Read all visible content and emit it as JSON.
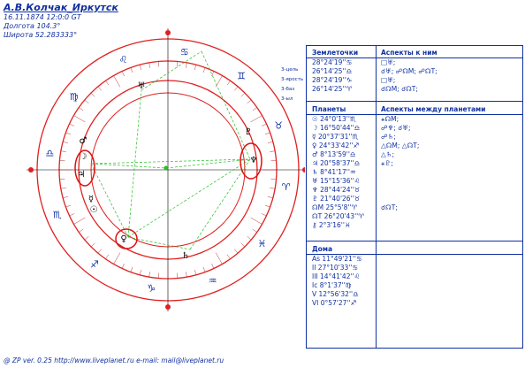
{
  "header": {
    "title": "А.В.Колчак_Иркутск",
    "date_line": "16.11.1874 12:0:0 GT",
    "longitude": "Долгота 104.3°",
    "latitude": "Широта 52.283333°"
  },
  "colors": {
    "text": "#1030a0",
    "outer_ring": "#e02020",
    "aspect_green": "#20c020",
    "circle_red": "#e01010"
  },
  "chart_labels": {
    "zodiac_signs": [
      "♌",
      "♋",
      "♊",
      "♉",
      "♈",
      "♓",
      "♒",
      "♑",
      "♐",
      "♏",
      "♎",
      "♍"
    ],
    "planet_glyphs": {
      "saturn": "♅",
      "mercury": "☿",
      "pluto": "♇",
      "neptune": "♆",
      "sun": "☉",
      "moon": "☽",
      "venus": "♀",
      "mars": "♂",
      "jupiter": "♃",
      "saturn2": "♄"
    },
    "legend": [
      "3-цель",
      "3-ярость",
      "3-баз",
      "3-ыл"
    ]
  },
  "table": {
    "earthpoints": {
      "head1": "Землеточки",
      "head2": "Аспекты к ним",
      "rows": [
        {
          "c1": "28°24'19''♋",
          "c2": "□♅;"
        },
        {
          "c1": "26°14'25''♎",
          "c2": "☌♅; ☍☊M; ☍☊T;"
        },
        {
          "c1": "28°24'19''♑",
          "c2": "□♅;"
        },
        {
          "c1": "26°14'25''♈",
          "c2": "☌☊M; ☌☊T;"
        }
      ]
    },
    "planets": {
      "head1": "Планеты",
      "head2": "Аспекты между планетами",
      "rows": [
        {
          "c1": "☉ 24°0'13''♏",
          "c2": "⚹☊M;"
        },
        {
          "c1": "☽ 16°50'44''♎",
          "c2": "☍♆; ☌♅;"
        },
        {
          "c1": "☿ 20°37'31''♏",
          "c2": "☍♄;"
        },
        {
          "c1": "♀ 24°33'42''♐",
          "c2": "△☊M; △☊T;"
        },
        {
          "c1": "♂ 8°13'59''♎",
          "c2": "△♄;"
        },
        {
          "c1": "♃ 20°58'37''♎",
          "c2": "⚹♇;"
        },
        {
          "c1": "♄ 8°41'17''♒",
          "c2": ""
        },
        {
          "c1": "♅ 15°15'36''♌",
          "c2": ""
        },
        {
          "c1": "♆ 28°44'24''♉",
          "c2": ""
        },
        {
          "c1": "♇ 21°40'26''♉",
          "c2": ""
        },
        {
          "c1": "☊M 25°5'8''♈",
          "c2": "☌☊T;"
        },
        {
          "c1": "☊T 26°20'43''♈",
          "c2": ""
        },
        {
          "c1": "⚷ 2°3'16''♓",
          "c2": ""
        }
      ]
    },
    "houses": {
      "head1": "Дома",
      "rows": [
        {
          "c1": "As 11°49'21''♋"
        },
        {
          "c1": "II 27°10'33''♋"
        },
        {
          "c1": "III 14°41'42''♌"
        },
        {
          "c1": "Ic 8°1'37''♍"
        },
        {
          "c1": "V 12°56'32''♎"
        },
        {
          "c1": "VI 0°57'27''♐"
        }
      ]
    }
  },
  "footer": "@ ZP  ver. 0.25 http://www.liveplanet.ru  e-mail: mail@liveplanet.ru"
}
